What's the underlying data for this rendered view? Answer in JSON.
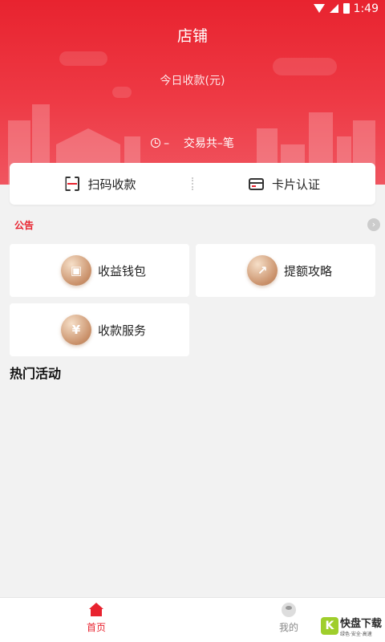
{
  "status_bar": {
    "time": "1:49"
  },
  "header": {
    "title": "店铺",
    "subtitle": "今日收款(元)",
    "trade_amount": "–",
    "trade_count": "交易共–笔"
  },
  "actions": {
    "scan_label": "扫码收款",
    "card_label": "卡片认证"
  },
  "notice": {
    "tag": "公告"
  },
  "tiles": [
    {
      "label": "收益钱包",
      "icon": "wallet-icon"
    },
    {
      "label": "提额攻略",
      "icon": "trend-chart-icon"
    },
    {
      "label": "收款服务",
      "icon": "yuan-hand-icon"
    }
  ],
  "hot_section": {
    "title": "热门活动"
  },
  "tab_bar": {
    "home_label": "首页",
    "mine_label": "我的"
  },
  "watermark": {
    "text": "快盘下载",
    "small": "绿色·安全·高速"
  },
  "colors": {
    "primary": "#e8232f",
    "tile_icon": "#c99069"
  }
}
